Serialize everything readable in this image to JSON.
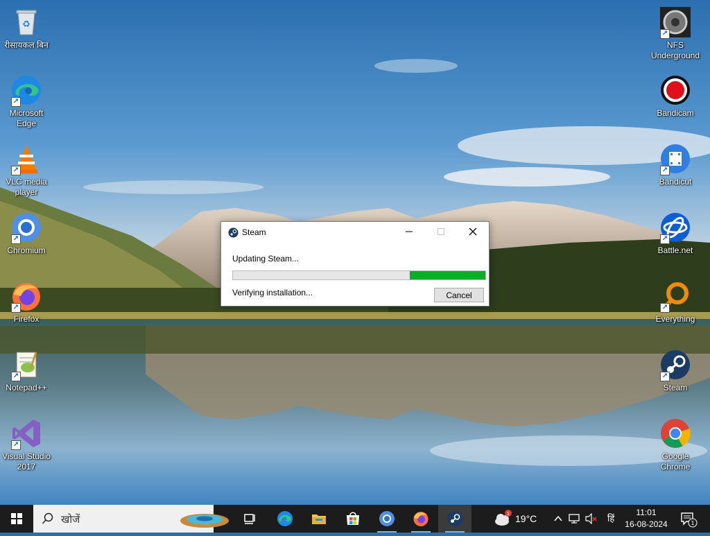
{
  "desktop": {
    "left_icons": [
      {
        "label": "रीसायकल बिन",
        "icon": "recycle-bin-icon"
      },
      {
        "label": "Microsoft Edge",
        "icon": "edge-icon"
      },
      {
        "label": "VLC media player",
        "icon": "vlc-icon"
      },
      {
        "label": "Chromium",
        "icon": "chromium-icon"
      },
      {
        "label": "Firefox",
        "icon": "firefox-icon"
      },
      {
        "label": "Notepad++",
        "icon": "notepadpp-icon"
      },
      {
        "label": "Visual Studio 2017",
        "icon": "visual-studio-icon"
      }
    ],
    "right_icons": [
      {
        "label": "NFS Underground",
        "icon": "nfs-icon"
      },
      {
        "label": "Bandicam",
        "icon": "bandicam-icon"
      },
      {
        "label": "Bandicut",
        "icon": "bandicut-icon"
      },
      {
        "label": "Battle.net",
        "icon": "battlenet-icon"
      },
      {
        "label": "Everything",
        "icon": "everything-icon"
      },
      {
        "label": "Steam",
        "icon": "steam-icon"
      },
      {
        "label": "Google Chrome",
        "icon": "chrome-icon"
      }
    ]
  },
  "dialog": {
    "title": "Steam",
    "status": "Updating Steam...",
    "progress_shown": 0.3,
    "detail": "Verifying installation...",
    "cancel_label": "Cancel",
    "progress_color": "#06b025"
  },
  "taskbar": {
    "search_placeholder": "खोजें",
    "apps": [
      "task-view-icon",
      "edge-icon",
      "file-explorer-icon",
      "store-icon",
      "chromium-icon",
      "firefox-icon",
      "steam-icon"
    ],
    "weather_temp": "19°C",
    "weather_badge": "1",
    "language": "हिं",
    "time": "11:01",
    "date": "16-08-2024",
    "notification_count": "1"
  }
}
